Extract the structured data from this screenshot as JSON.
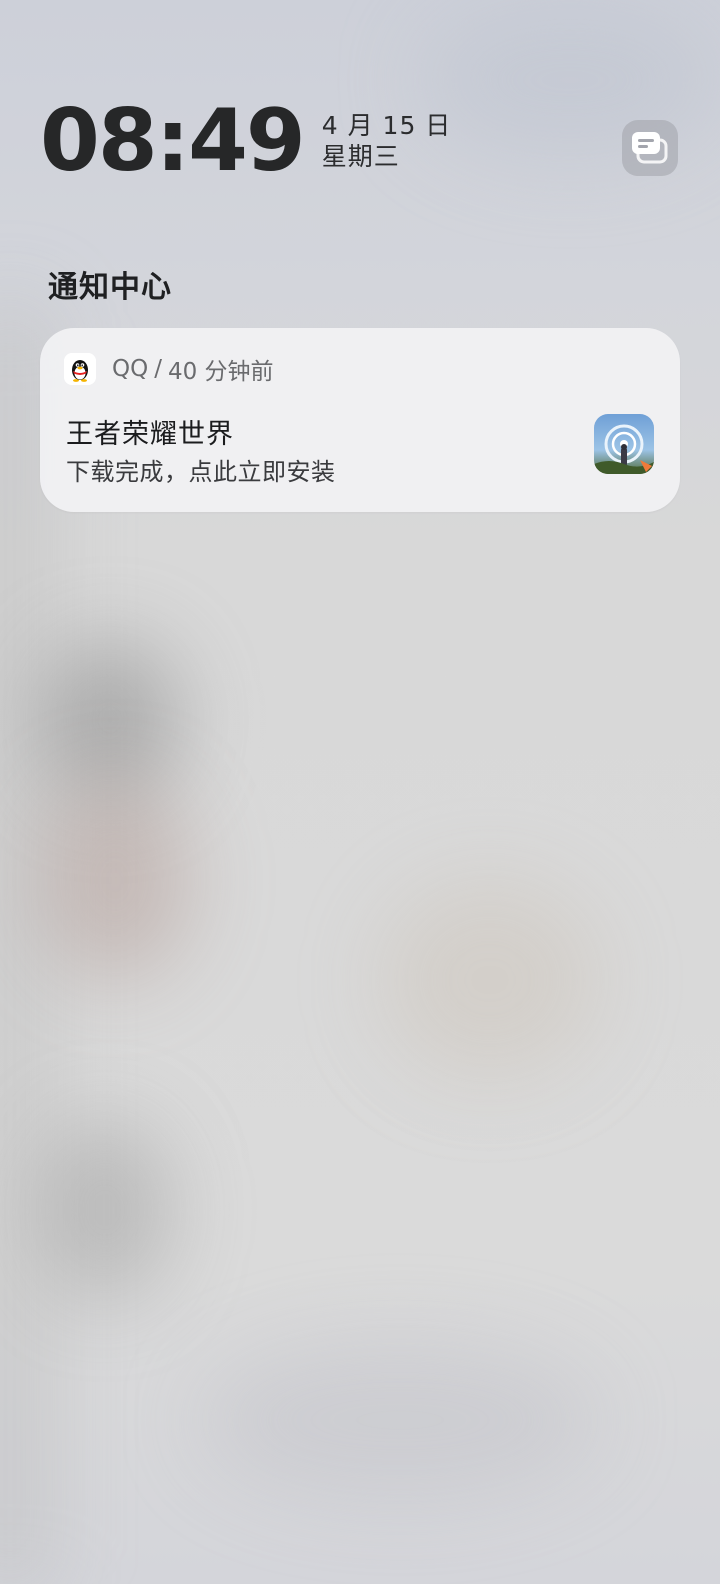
{
  "lockscreen": {
    "time": "08:49",
    "date": "4 月 15 日",
    "weekday": "星期三",
    "message_button_icon": "message-stack-icon"
  },
  "notification_center": {
    "title": "通知中心",
    "notifications": [
      {
        "app_name": "QQ",
        "separator": "/",
        "time_ago": "40 分钟前",
        "app_icon": "qq-penguin-icon",
        "title": "王者荣耀世界",
        "body": "下载完成，点此立即安装",
        "thumbnail_icon": "game-thumbnail-icon"
      }
    ]
  },
  "colors": {
    "text_primary": "#1b1c1e",
    "text_secondary": "#6a6b6e",
    "card_bg": "#f2f2f4"
  }
}
